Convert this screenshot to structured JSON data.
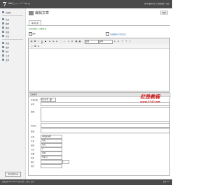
{
  "app": {
    "site_title": "Wo?_ー—ー˂¬¢¬¿",
    "top_right": "版本 最新消息 | 控制面板 | 退出"
  },
  "sidebar": {
    "items": [
      {
        "label": "控制板"
      },
      {
        "label": "文章"
      },
      {
        "label": "媒体"
      },
      {
        "label": "链接"
      },
      {
        "label": "页面"
      },
      {
        "label": "评论"
      },
      {
        "label": "外观"
      },
      {
        "label": "插件"
      },
      {
        "label": "用户"
      },
      {
        "label": "工具"
      },
      {
        "label": "设置"
      }
    ]
  },
  "main": {
    "title": "编辑文章",
    "help": "帮助",
    "tab": "基本信息",
    "green_note": "文章已更新。查看文章",
    "checkbox_label": "发布",
    "link_right": "添加媒体文件到文章"
  },
  "editor": {
    "format_select": "段落",
    "font_select": "字体"
  },
  "form": {
    "heading": "文章属性",
    "rows": [
      {
        "label": "文章分类",
        "value": "默认分类"
      },
      {
        "label": "标签",
        "value": ""
      },
      {
        "label": "摘要",
        "value": ""
      },
      {
        "label": "关键词",
        "value": ""
      },
      {
        "label": "描述",
        "value": ""
      },
      {
        "label": "来源",
        "value": "中国装饰网"
      },
      {
        "label": "作者",
        "value": "李海"
      },
      {
        "label": "编辑",
        "value": "张伟"
      },
      {
        "label": "点击",
        "value": "0"
      },
      {
        "label": "权重",
        "value": "常规"
      },
      {
        "label": "链接",
        "value": "http://"
      },
      {
        "label": "图片",
        "value": ""
      },
      {
        "label": "附件",
        "value": ""
      }
    ]
  },
  "watermark": {
    "top": "红签教程",
    "bottom": "www.7747.net"
  },
  "submit_label": "保存修改内容",
  "footer": {
    "left": "感谢使用 WordPress 进行创作。文档 | 反馈",
    "right": "版本 3.0"
  }
}
